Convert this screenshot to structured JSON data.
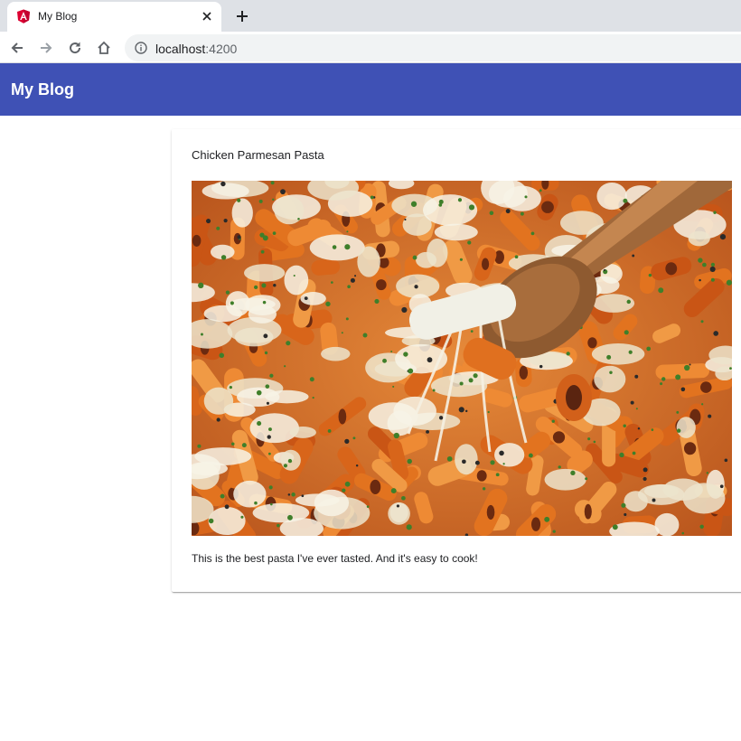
{
  "browser": {
    "tab": {
      "title": "My Blog",
      "favicon": "angular-logo-icon",
      "close_icon": "close-icon"
    },
    "new_tab_icon": "plus-icon",
    "nav": {
      "back_icon": "arrow-left-icon",
      "forward_icon": "arrow-right-icon",
      "reload_icon": "reload-icon",
      "home_icon": "home-icon"
    },
    "address": {
      "host": "localhost",
      "port": ":4200",
      "info_icon": "info-icon"
    }
  },
  "app": {
    "title": "My Blog",
    "toolbar_color": "#3f51b5"
  },
  "post": {
    "title": "Chicken Parmesan Pasta",
    "image_subject": "baked penne pasta with melted cheese on a wooden spoon",
    "body": "This is the best pasta I've ever tasted. And it's easy to cook!"
  }
}
